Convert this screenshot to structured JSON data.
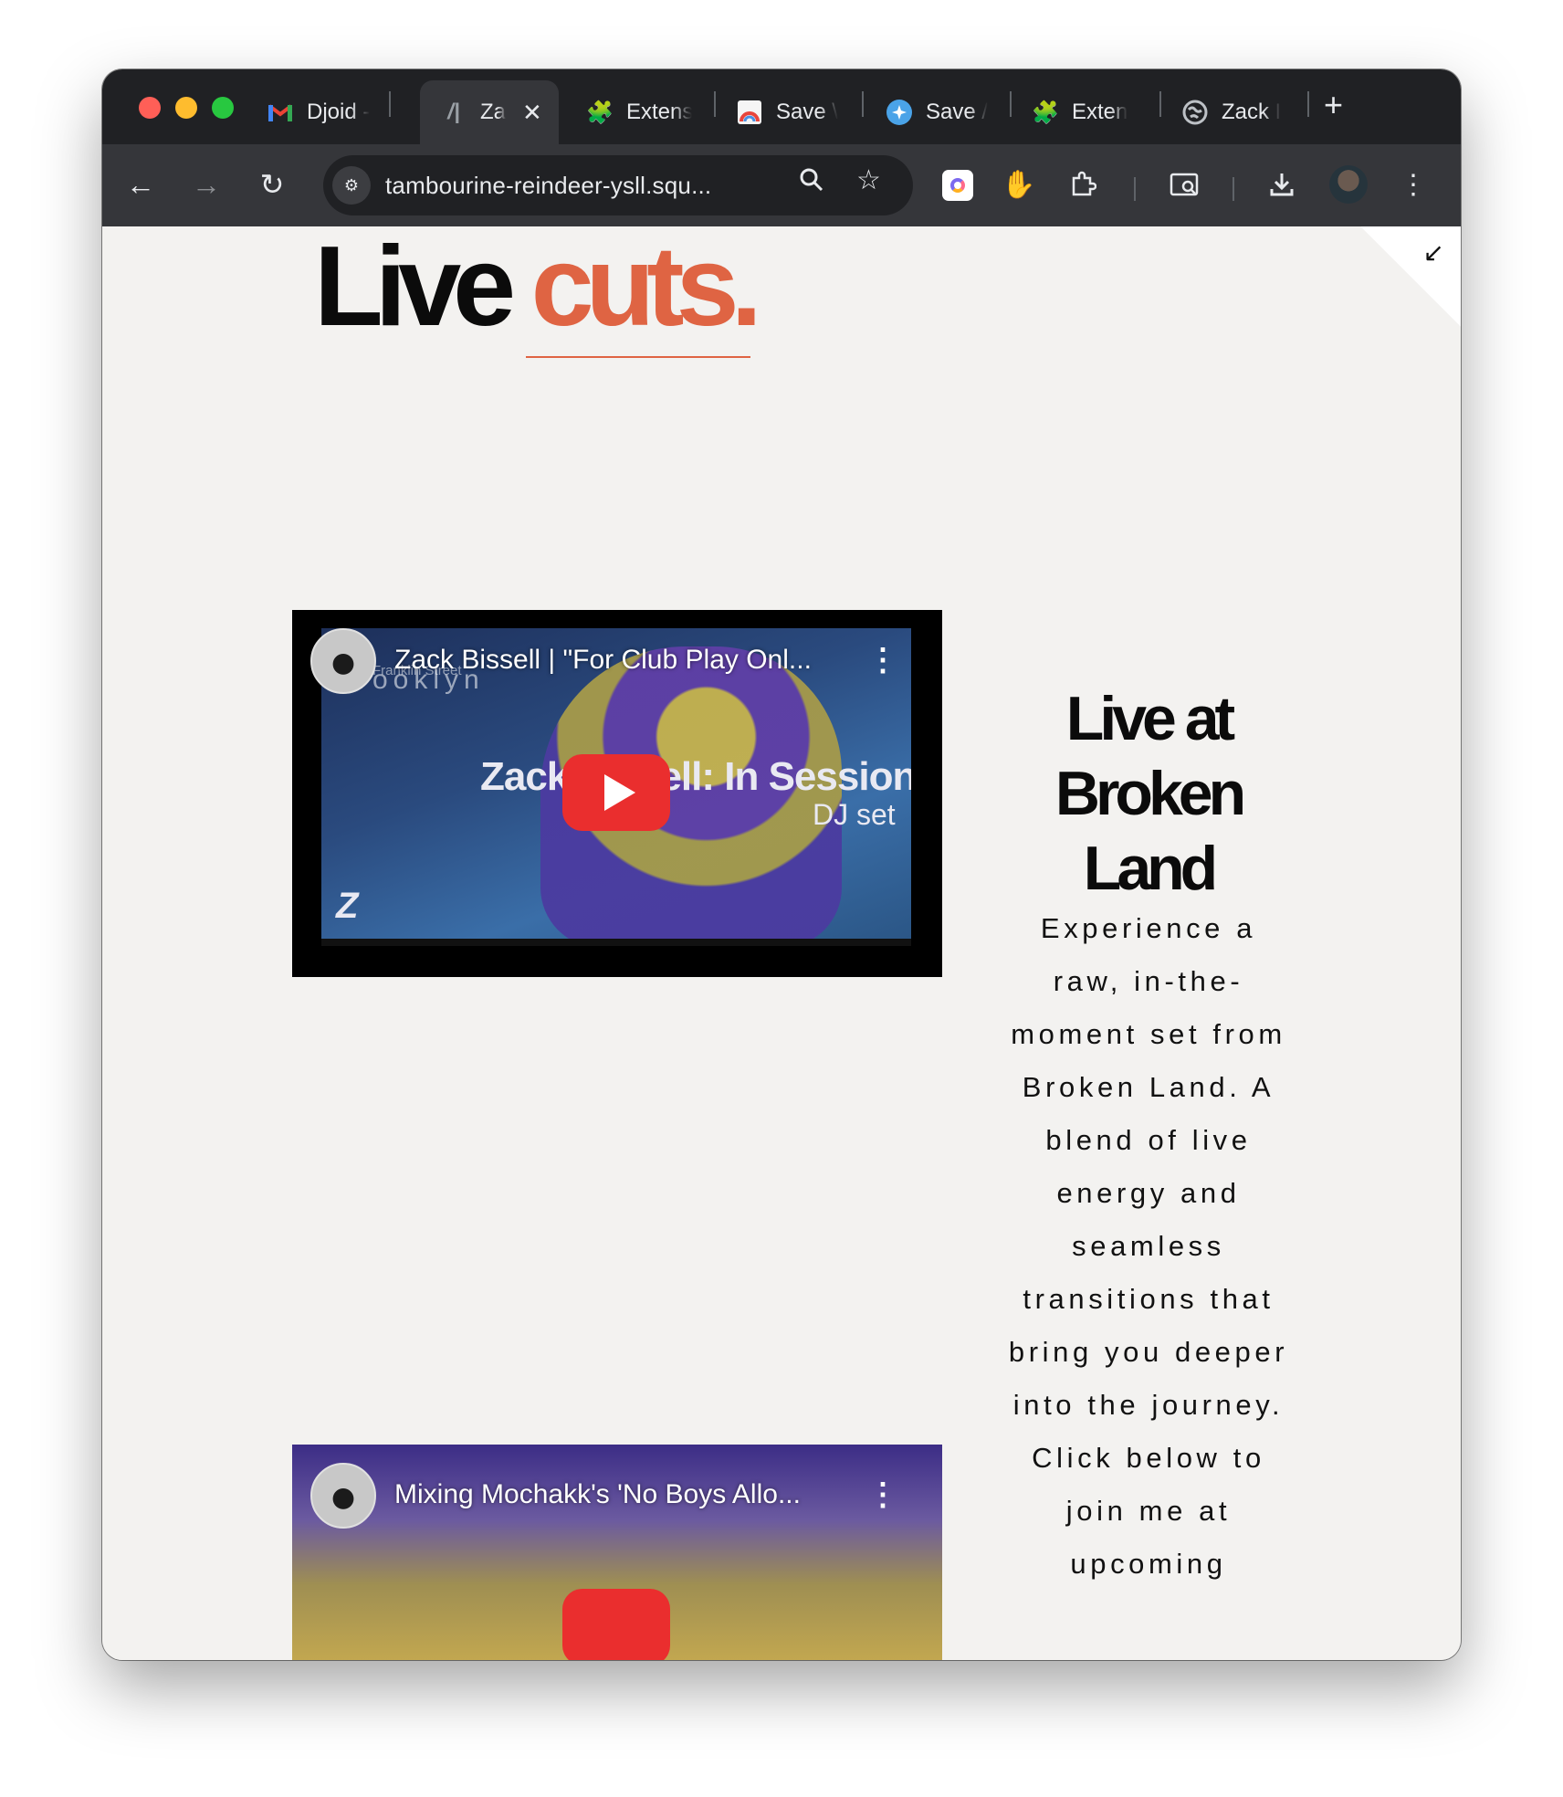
{
  "browser": {
    "tabs": [
      {
        "title": "Djoid -",
        "icon": "gmail-icon",
        "active": false
      },
      {
        "title": "Za",
        "icon": "zack-logo-icon",
        "active": true
      },
      {
        "title": "Extens",
        "icon": "puzzle-icon",
        "active": false
      },
      {
        "title": "Save \\",
        "icon": "save-extension-icon",
        "active": false
      },
      {
        "title": "Save /",
        "icon": "save-extension-icon",
        "active": false
      },
      {
        "title": "Exten",
        "icon": "puzzle-icon",
        "active": false
      },
      {
        "title": "Zack I",
        "icon": "globe-icon",
        "active": false
      }
    ],
    "close_glyph": "✕",
    "new_tab_glyph": "+",
    "url": "tambourine-reindeer-ysll.squ..."
  },
  "page": {
    "hero": {
      "title_plain": "Live",
      "title_accent": "cuts."
    },
    "videos": [
      {
        "title": "Zack Bissell | \"For Club Play Onl...",
        "overlay_main": "Zack Bissell: In Session",
        "overlay_sub": "DJ set",
        "overlay_location": "Brooklyn",
        "overlay_street": "Franklin  Street",
        "logo_letter": "Z"
      },
      {
        "title": "Mixing Mochakk's 'No Boys Allo..."
      }
    ],
    "side_heading": "Live at Broken Land",
    "side_body": "Experience a raw, in-the-moment set from Broken Land. A blend of live energy and seamless transitions that bring you deeper into the journey. Click below to join me at upcoming"
  },
  "colors": {
    "accent": "#df6443",
    "page_bg": "#f3f2f0",
    "chrome_dark": "#202124",
    "chrome_toolbar": "#35363a",
    "play_red": "#ea2e2e"
  }
}
